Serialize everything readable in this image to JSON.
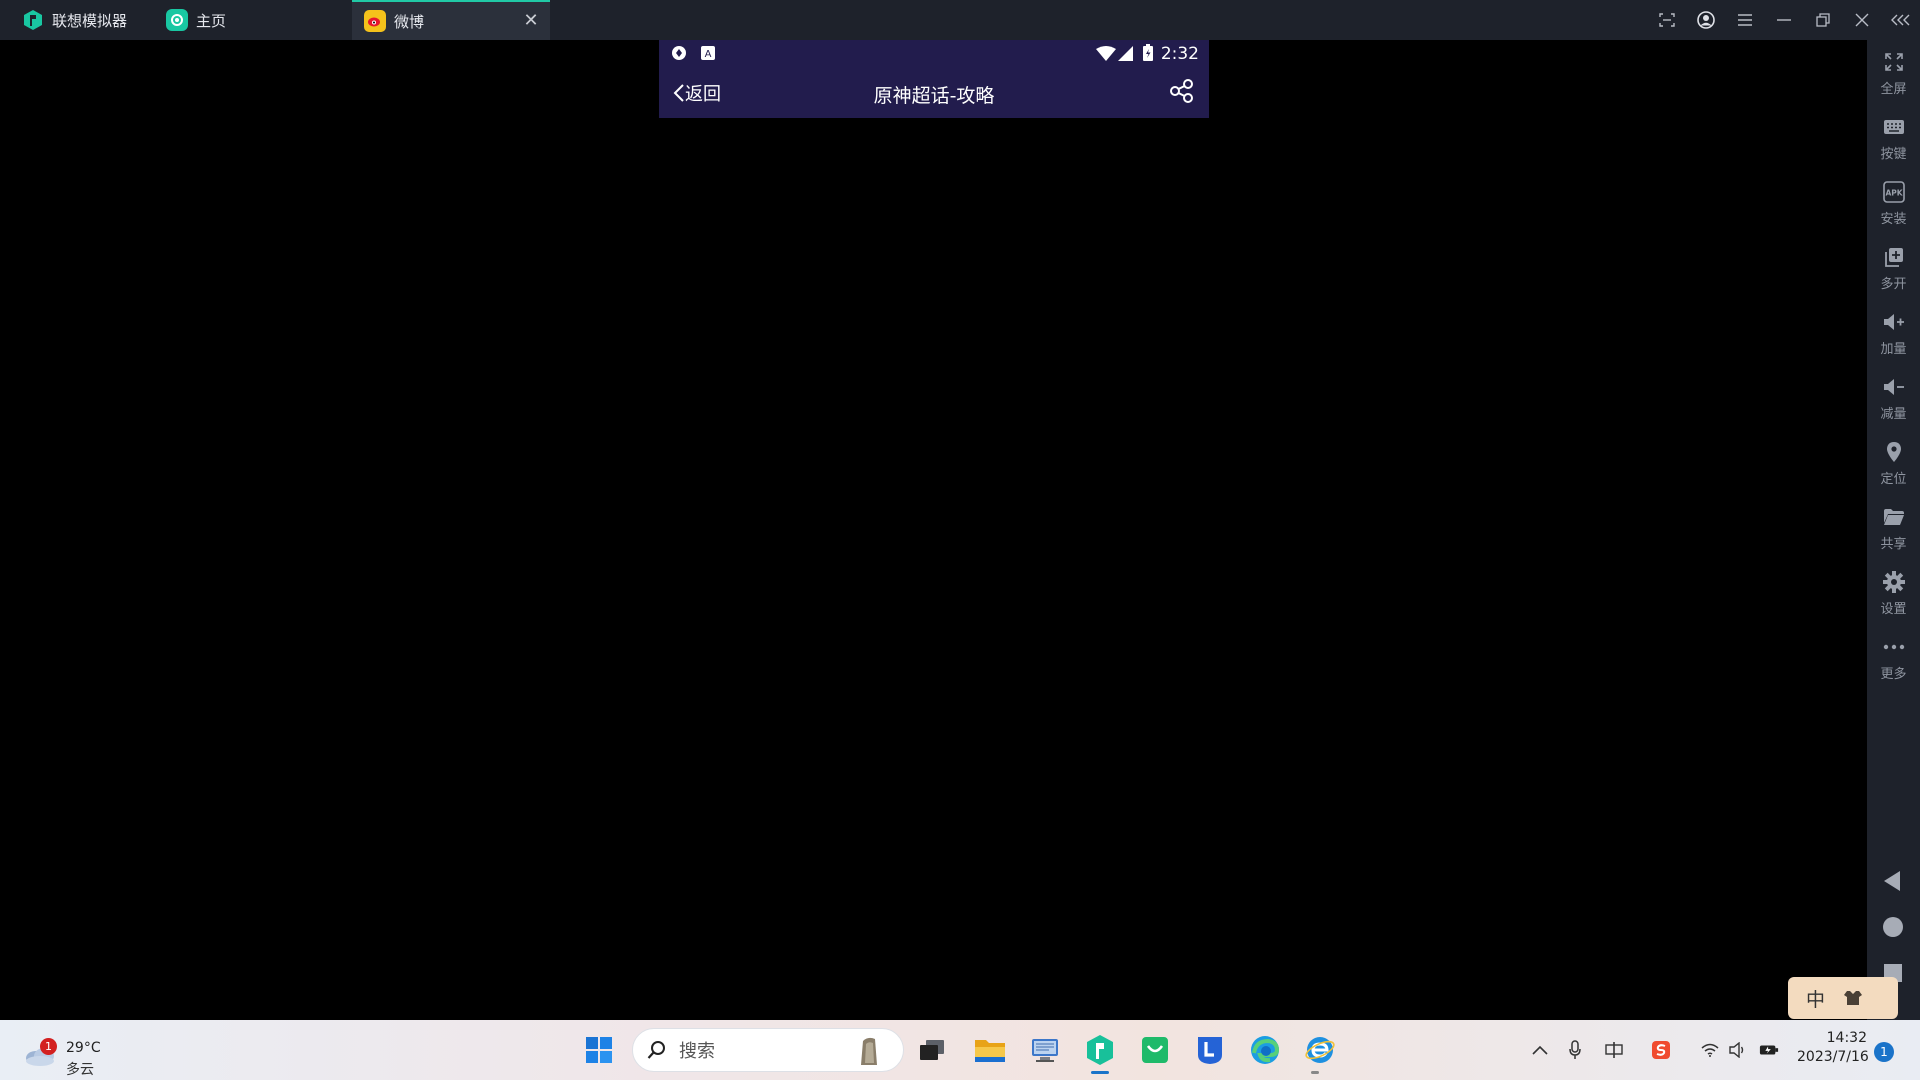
{
  "titlebar": {
    "app_name": "联想模拟器",
    "tabs": [
      {
        "label": "主页"
      },
      {
        "label": "微博"
      }
    ],
    "close_glyph": "✕"
  },
  "phone": {
    "status_time": "2:32",
    "back_label": "返回",
    "page_title": "原神超话-攻略"
  },
  "right_toolbar": {
    "items": [
      {
        "label": "全屏",
        "icon": "fullscreen-icon"
      },
      {
        "label": "按键",
        "icon": "keyboard-icon"
      },
      {
        "label": "安装",
        "icon": "apk-icon"
      },
      {
        "label": "多开",
        "icon": "multi-instance-icon"
      },
      {
        "label": "加量",
        "icon": "volume-up-icon"
      },
      {
        "label": "减量",
        "icon": "volume-down-icon"
      },
      {
        "label": "定位",
        "icon": "location-icon"
      },
      {
        "label": "共享",
        "icon": "folder-icon"
      },
      {
        "label": "设置",
        "icon": "gear-icon"
      },
      {
        "label": "更多",
        "icon": "more-icon"
      }
    ]
  },
  "ime": {
    "mode": "中"
  },
  "taskbar": {
    "weather_badge": "1",
    "weather_temp": "29°C",
    "weather_desc": "多云",
    "search_placeholder": "搜索",
    "clock_time": "14:32",
    "clock_date": "2023/7/16",
    "notification_count": "1"
  },
  "colors": {
    "accent": "#21c9a6",
    "phone_header": "#221c4d",
    "titlebar": "#1e222b"
  }
}
